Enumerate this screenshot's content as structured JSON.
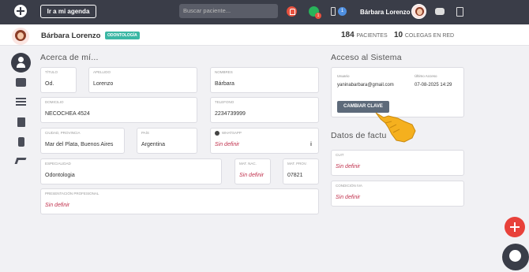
{
  "topbar": {
    "agenda_label": "Ir a mi agenda",
    "search_placeholder": "Buscar paciente...",
    "whatsapp_badge": "1",
    "blue_badge": "1",
    "user_name": "Bárbara Lorenzo",
    "icons": [
      "plus-icon",
      "bell-icon",
      "whatsapp-icon",
      "phone-icon",
      "chat-icon",
      "clipboard-icon"
    ]
  },
  "profile": {
    "name": "Bárbara Lorenzo",
    "specialty_badge": "ODONTOLOGÍA",
    "patients_count": "184",
    "patients_label": "PACIENTES",
    "colleagues_count": "10",
    "colleagues_label": "COLEGAS EN RED"
  },
  "sidenav": {
    "icons": [
      "user-icon",
      "camera-icon",
      "list-icon",
      "building-icon",
      "mobile-icon",
      "reply-icon"
    ]
  },
  "about": {
    "title": "Acerca de mí...",
    "titulo": {
      "label": "TÍTULO",
      "value": "Od."
    },
    "apellido": {
      "label": "APELLIDO",
      "value": "Lorenzo"
    },
    "nombres": {
      "label": "NOMBRES",
      "value": "Bárbara"
    },
    "domicilio": {
      "label": "DOMICILIO",
      "value": "NECOCHEA 4524"
    },
    "telefono": {
      "label": "TELEFONO",
      "value": "2234739999"
    },
    "ciudad": {
      "label": "CIUDAD, PROVINCIA",
      "value": "Mar del Plata, Buenos Aires"
    },
    "pais": {
      "label": "PAÍS",
      "value": "Argentina"
    },
    "whatsapp": {
      "label": "WHATSAPP",
      "value": "Sin definir"
    },
    "especialidad": {
      "label": "ESPECIALIDAD",
      "value": "Odontologia"
    },
    "mat_nac": {
      "label": "MAT. NAC.",
      "value": "Sin definir"
    },
    "mat_prov": {
      "label": "MAT. PROV.",
      "value": "07821"
    },
    "presentacion": {
      "label": "PRESENTACIÓN PROFESIONAL",
      "value": "Sin definir"
    }
  },
  "access": {
    "title": "Acceso al Sistema",
    "user_label": "Usuario",
    "user_value": "yaninabarbara@gmail.com",
    "last_access_label": "Último Acceso",
    "last_access_value": "07-08-2025 14:29",
    "change_key_label": "CAMBIAR CLAVE"
  },
  "billing": {
    "title": "Datos de factu",
    "cuit": {
      "label": "CUIT",
      "value": "Sin definir"
    },
    "condicion": {
      "label": "CONDICIÓN IVA",
      "value": "Sin definir"
    }
  },
  "colors": {
    "topbar": "#3a3d48",
    "accent_red": "#e8413a",
    "badge_teal": "#3bb7a4",
    "undefined_text": "#c0304c"
  }
}
